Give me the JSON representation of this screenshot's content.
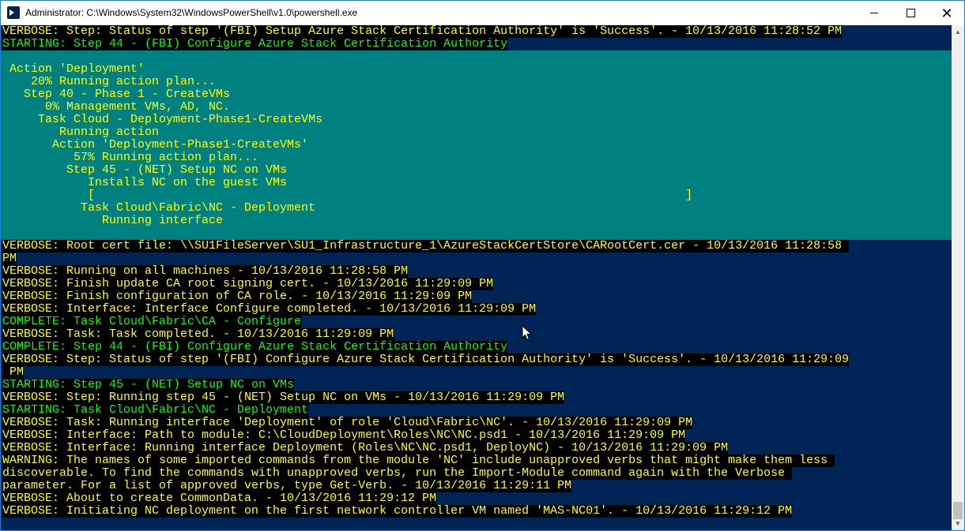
{
  "window": {
    "title": "Administrator: C:\\Windows\\System32\\WindowsPowerShell\\v1.0\\powershell.exe",
    "icon": "powershell-icon",
    "controls": {
      "minimize": "minimize-icon",
      "maximize": "maximize-icon",
      "close": "close-icon"
    }
  },
  "colors": {
    "console_bg": "#012456",
    "text_yellow": "#ffff00",
    "text_green": "#00ff00",
    "progress_bg": "#008080",
    "line_bg": "#000000"
  },
  "console": {
    "header_lines": [
      "VERBOSE: Step: Status of step '(FBI) Setup Azure Stack Certification Authority' is 'Success'. - 10/13/2016 11:28:52 PM",
      "STARTING: Step 44 - (FBI) Configure Azure Stack Certification Authority"
    ],
    "progress": [
      "",
      " Action 'Deployment'",
      "    20% Running action plan...",
      "   Step 40 - Phase 1 - CreateVMs",
      "      0% Management VMs, AD, NC.",
      "     Task Cloud - Deployment-Phase1-CreateVMs",
      "        Running action",
      "       Action 'Deployment-Phase1-CreateVMs'",
      "          57% Running action plan...",
      "         Step 45 - (NET) Setup NC on VMs",
      "            Installs NC on the guest VMs",
      "            [                                                                                   ]",
      "           Task Cloud\\Fabric\\NC - Deployment",
      "              Running interface",
      ""
    ],
    "log_lines": [
      {
        "type": "verbose",
        "text": "VERBOSE: Root cert file: \\\\SU1FileServer\\SU1_Infrastructure_1\\AzureStackCertStore\\CARootCert.cer - 10/13/2016 11:28:58 "
      },
      {
        "type": "verbose",
        "text": "PM"
      },
      {
        "type": "verbose",
        "text": "VERBOSE: Running on all machines - 10/13/2016 11:28:58 PM"
      },
      {
        "type": "verbose",
        "text": "VERBOSE: Finish update CA root signing cert. - 10/13/2016 11:29:09 PM"
      },
      {
        "type": "verbose",
        "text": "VERBOSE: Finish configuration of CA role. - 10/13/2016 11:29:09 PM"
      },
      {
        "type": "verbose",
        "text": "VERBOSE: Interface: Interface Configure completed. - 10/13/2016 11:29:09 PM"
      },
      {
        "type": "green",
        "text": "COMPLETE: Task Cloud\\Fabric\\CA - Configure"
      },
      {
        "type": "verbose",
        "text": "VERBOSE: Task: Task completed. - 10/13/2016 11:29:09 PM"
      },
      {
        "type": "green",
        "text": "COMPLETE: Step 44 - (FBI) Configure Azure Stack Certification Authority"
      },
      {
        "type": "verbose",
        "text": "VERBOSE: Step: Status of step '(FBI) Configure Azure Stack Certification Authority' is 'Success'. - 10/13/2016 11:29:09"
      },
      {
        "type": "verbose",
        "text": " PM"
      },
      {
        "type": "green",
        "text": "STARTING: Step 45 - (NET) Setup NC on VMs"
      },
      {
        "type": "verbose",
        "text": "VERBOSE: Step: Running step 45 - (NET) Setup NC on VMs - 10/13/2016 11:29:09 PM"
      },
      {
        "type": "green",
        "text": "STARTING: Task Cloud\\Fabric\\NC - Deployment"
      },
      {
        "type": "verbose",
        "text": "VERBOSE: Task: Running interface 'Deployment' of role 'Cloud\\Fabric\\NC'. - 10/13/2016 11:29:09 PM"
      },
      {
        "type": "verbose",
        "text": "VERBOSE: Interface: Path to module: C:\\CloudDeployment\\Roles\\NC\\NC.psd1 - 10/13/2016 11:29:09 PM"
      },
      {
        "type": "verbose",
        "text": "VERBOSE: Interface: Running interface Deployment (Roles\\NC\\NC.psd1, DeployNC) - 10/13/2016 11:29:09 PM"
      },
      {
        "type": "warning",
        "text": "WARNING: The names of some imported commands from the module 'NC' include unapproved verbs that might make them less "
      },
      {
        "type": "warning",
        "text": "discoverable. To find the commands with unapproved verbs, run the Import-Module command again with the Verbose "
      },
      {
        "type": "warning",
        "text": "parameter. For a list of approved verbs, type Get-Verb. - 10/13/2016 11:29:11 PM"
      },
      {
        "type": "verbose",
        "text": "VERBOSE: About to create CommonData. - 10/13/2016 11:29:12 PM"
      },
      {
        "type": "verbose",
        "text": "VERBOSE: Initiating NC deployment on the first network controller VM named 'MAS-NC01'. - 10/13/2016 11:29:12 PM"
      },
      {
        "type": "blank",
        "text": ""
      },
      {
        "type": "cursor",
        "text": "_"
      }
    ]
  }
}
